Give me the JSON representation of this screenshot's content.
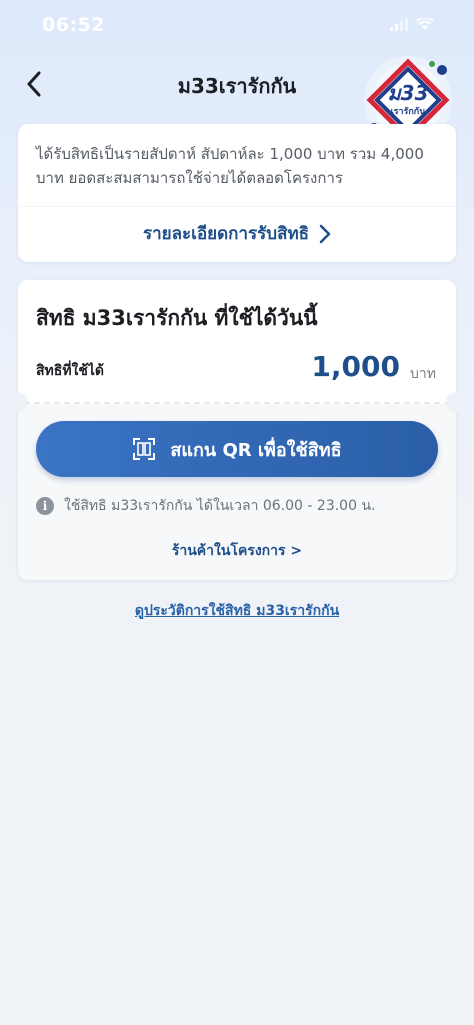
{
  "status_bar": {
    "time": "06:52"
  },
  "header": {
    "title": "ม33เรารักกัน",
    "logo_text_main": "ม33",
    "logo_text_sub": "เรารักกัน"
  },
  "info_card": {
    "description": "ได้รับสิทธิเป็นรายสัปดาห์ สัปดาห์ละ 1,000 บาท รวม 4,000 บาท ยอดสะสมสามารถใช้จ่ายได้ตลอดโครงการ",
    "details_link": "รายละเอียดการรับสิทธิ"
  },
  "rights_card": {
    "title": "สิทธิ ม33เรารักกัน ที่ใช้ได้วันนี้",
    "available_label": "สิทธิที่ใช้ได้",
    "available_amount": "1,000",
    "currency_unit": "บาท",
    "scan_button": "สแกน QR เพื่อใช้สิทธิ",
    "usage_note": "ใช้สิทธิ ม33เรารักกัน ได้ในเวลา 06.00 - 23.00 น.",
    "shops_link": "ร้านค้าในโครงการ >"
  },
  "history_link": "ดูประวัติการใช้สิทธิ ม33เรารักกัน",
  "colors": {
    "primary": "#2a5ea8",
    "accent_text": "#1f4f8a",
    "background": "#eff2f7"
  },
  "icons": [
    "back-chevron-icon",
    "chevron-right-icon",
    "qr-scan-icon",
    "info-icon",
    "signal-icon",
    "wifi-icon"
  ]
}
